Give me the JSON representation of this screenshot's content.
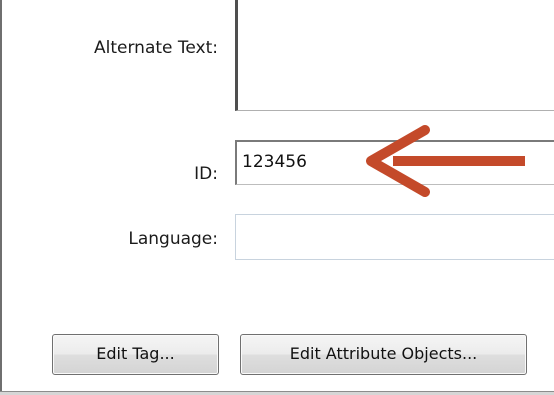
{
  "form": {
    "alternate_text": {
      "label": "Alternate Text:",
      "value": ""
    },
    "id": {
      "label": "ID:",
      "value": "123456"
    },
    "language": {
      "label": "Language:",
      "value": ""
    }
  },
  "buttons": {
    "edit_tag": "Edit Tag...",
    "edit_attribute_objects": "Edit Attribute Objects..."
  },
  "annotation": {
    "arrow_color": "#c44a2a",
    "icon": "left-arrow-icon"
  }
}
